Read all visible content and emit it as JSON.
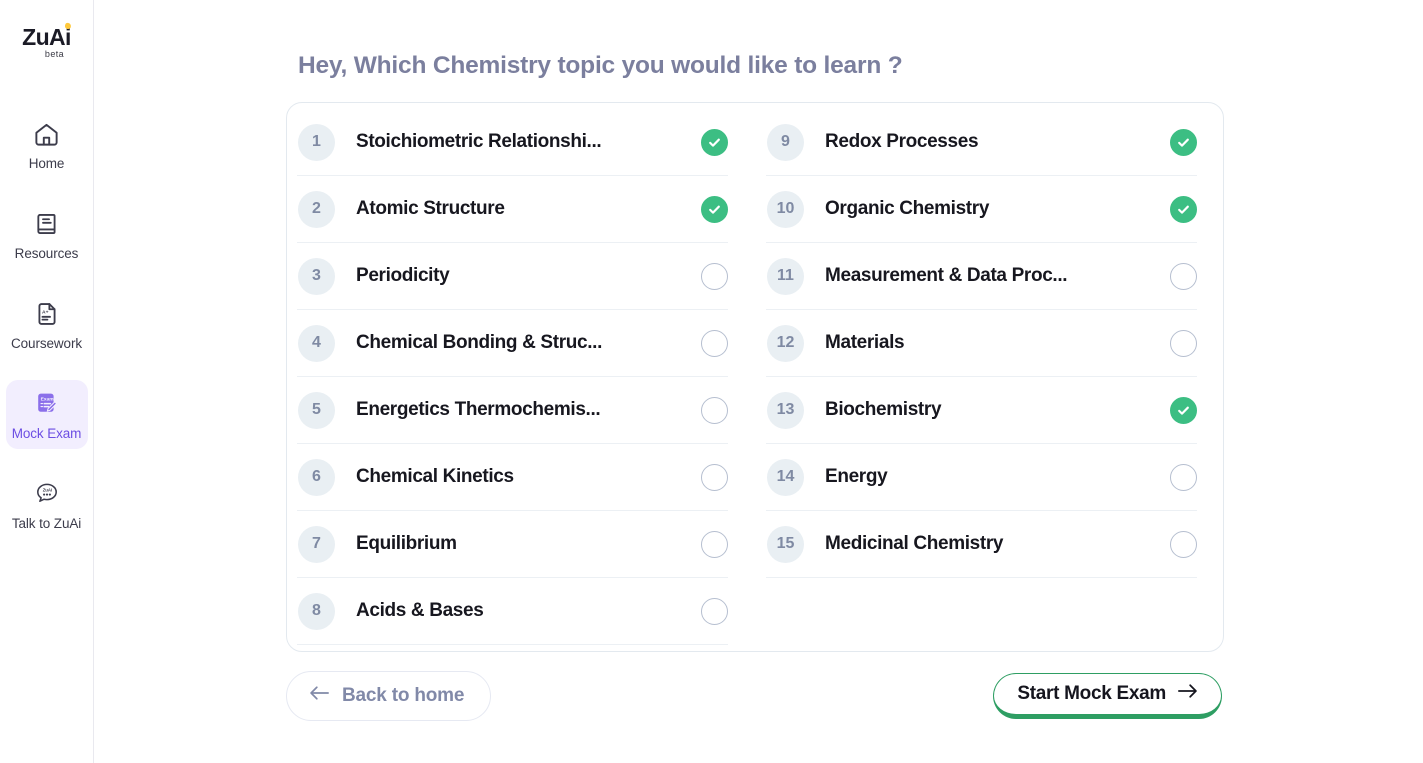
{
  "brand": {
    "logo_text": "ZuAi",
    "logo_badge": "beta"
  },
  "sidebar": {
    "items": [
      {
        "label": "Home",
        "icon": "home-icon",
        "active": false
      },
      {
        "label": "Resources",
        "icon": "book-icon",
        "active": false
      },
      {
        "label": "Coursework",
        "icon": "document-a-plus-icon",
        "active": false
      },
      {
        "label": "Mock Exam",
        "icon": "exam-paper-pencil-icon",
        "active": true
      },
      {
        "label": "Talk to ZuAi",
        "icon": "chat-bubble-icon",
        "active": false
      }
    ]
  },
  "main": {
    "title": "Hey, Which Chemistry topic you would like to learn ?",
    "columns": [
      {
        "topics": [
          {
            "number": "1",
            "label": "Stoichiometric Relationshi...",
            "selected": true
          },
          {
            "number": "2",
            "label": "Atomic Structure",
            "selected": true
          },
          {
            "number": "3",
            "label": "Periodicity",
            "selected": false
          },
          {
            "number": "4",
            "label": "Chemical Bonding & Struc...",
            "selected": false
          },
          {
            "number": "5",
            "label": "Energetics Thermochemis...",
            "selected": false
          },
          {
            "number": "6",
            "label": "Chemical Kinetics",
            "selected": false
          },
          {
            "number": "7",
            "label": "Equilibrium",
            "selected": false
          },
          {
            "number": "8",
            "label": "Acids & Bases",
            "selected": false
          }
        ]
      },
      {
        "topics": [
          {
            "number": "9",
            "label": "Redox Processes",
            "selected": true
          },
          {
            "number": "10",
            "label": "Organic Chemistry",
            "selected": true
          },
          {
            "number": "11",
            "label": "Measurement & Data Proc...",
            "selected": false
          },
          {
            "number": "12",
            "label": "Materials",
            "selected": false
          },
          {
            "number": "13",
            "label": "Biochemistry",
            "selected": true
          },
          {
            "number": "14",
            "label": "Energy",
            "selected": false
          },
          {
            "number": "15",
            "label": "Medicinal Chemistry",
            "selected": false
          }
        ]
      }
    ]
  },
  "footer": {
    "back_label": "Back to home",
    "start_label": "Start Mock Exam"
  },
  "colors": {
    "accent_purple": "#6C4EE3",
    "accent_purple_bg": "#F2EEFE",
    "check_green": "#3CBE83",
    "start_border_green": "#2E9E63",
    "title_gray": "#7B7F9E",
    "badge_bg": "#E9EFF3",
    "badge_text": "#7F8AA3",
    "logo_dot_yellow": "#FFC93C"
  }
}
